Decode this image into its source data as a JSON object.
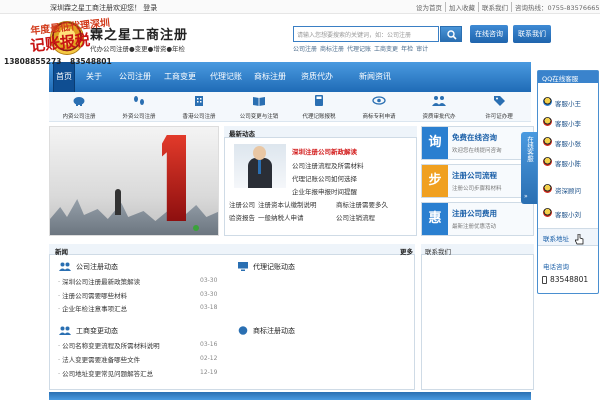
{
  "header": {
    "welcome": "深圳霖之星工商注册欢迎您！  登录",
    "top_links": [
      "设为首页",
      "加入收藏",
      "联系我们",
      "咨询热线：0755-83576665"
    ],
    "logo_title": "霖之星工商注册",
    "logo_subtitle": "代办公司注册●变更●增资●年检",
    "search_placeholder": "请输入您想要搜索的关键词，如：公司注册",
    "hot_words": [
      "公司注册",
      "商标注册",
      "代理记账",
      "工商变更",
      "年检",
      "审计"
    ],
    "btn_a": "在线咨询",
    "btn_b": "联系我们"
  },
  "nav": {
    "items": [
      "首页",
      "关于",
      "公司注册",
      "工商变更",
      "代理记账",
      "商标注册",
      "资质代办",
      "新闻资讯"
    ],
    "active_index": 0
  },
  "icons": [
    {
      "label": "内资公司注册",
      "icon": "piggy-bank-icon"
    },
    {
      "label": "外资公司注册",
      "icon": "footsteps-icon"
    },
    {
      "label": "香港公司注册",
      "icon": "building-icon"
    },
    {
      "label": "公司变更与注销",
      "icon": "book-icon"
    },
    {
      "label": "代理记账报税",
      "icon": "calculator-icon"
    },
    {
      "label": "商标专利申请",
      "icon": "eye-icon"
    },
    {
      "label": "资质审批代办",
      "icon": "people-icon"
    },
    {
      "label": "许可证办理",
      "icon": "tag-icon"
    }
  ],
  "banner": {
    "line1": "年度最低代理深圳",
    "line2": "记账报税",
    "phone1": "13808855273",
    "phone2": "83548801"
  },
  "news": {
    "title": "最新动态",
    "lines": [
      "深圳注册公司新政解读",
      "公司注册流程及所需材料",
      "代理记账公司如何选择",
      "企业年报申报时间提醒"
    ],
    "bottom": [
      [
        "注册公司",
        "注册资本认缴制说明",
        "商标注册需要多久"
      ],
      [
        "验资报告",
        "一般纳税人申请",
        "公司注销流程"
      ]
    ]
  },
  "services": [
    {
      "char": "询",
      "title": "免费在线咨询",
      "sub": "欢迎您在线提问咨询",
      "color": "#2a7fd0"
    },
    {
      "char": "步",
      "title": "注册公司流程",
      "sub": "注册公司步骤和材料",
      "color": "#f0a020"
    },
    {
      "char": "惠",
      "title": "注册公司费用",
      "sub": "最新注册优惠活动",
      "color": "#2a7fd0"
    }
  ],
  "lower": {
    "title": "新闻",
    "more": "更多",
    "sec1": {
      "title": "公司注册动态",
      "items": [
        {
          "text": "深圳公司注册最新政策解读",
          "date": "03-30"
        },
        {
          "text": "注册公司需要哪些材料",
          "date": "03-30"
        },
        {
          "text": "企业年检注意事项汇总",
          "date": "03-18"
        }
      ]
    },
    "sec2": {
      "title": "代理记账动态"
    },
    "sec3": {
      "title": "工商变更动态",
      "items": [
        {
          "text": "公司名称变更流程及所需材料说明",
          "date": "03-16"
        },
        {
          "text": "法人变更需要准备哪些文件",
          "date": "02-12"
        },
        {
          "text": "公司地址变更常见问题解答汇总",
          "date": "12-19"
        }
      ]
    },
    "sec4": {
      "title": "商标注册动态"
    }
  },
  "sidebox_title": "联系我们",
  "float": {
    "head": "QQ在线客服",
    "items": [
      "客服小王",
      "客服小李",
      "客服小张",
      "客服小陈",
      "资深顾问",
      "客服小刘"
    ],
    "tab": "在线客服",
    "tab_arrow": "»",
    "contact": "联系地址",
    "phone_head": "电话咨询",
    "phone": "83548801"
  }
}
